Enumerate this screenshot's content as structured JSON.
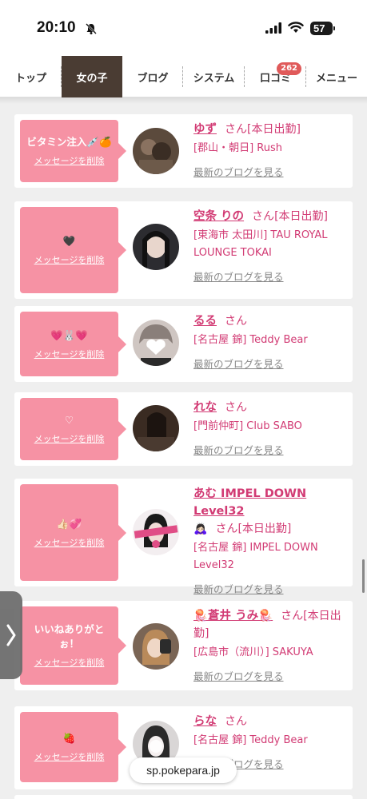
{
  "status_bar": {
    "time": "20:10",
    "battery": "57"
  },
  "nav": {
    "tabs": [
      {
        "label": "トップ"
      },
      {
        "label": "女の子"
      },
      {
        "label": "ブログ"
      },
      {
        "label": "システム"
      },
      {
        "label": "口コミ",
        "badge": "262"
      },
      {
        "label": "メニュー"
      }
    ]
  },
  "delete_label": "メッセージを削除",
  "san_label": "さん",
  "blog_label": "最新のブログを見る",
  "girls": [
    {
      "message": "ビタミン注入💉🍊",
      "name": "ゆず",
      "suffix": "[本日出勤]",
      "shop": "[郡山・朝日] Rush"
    },
    {
      "message": "🖤",
      "name": "空条 りの",
      "suffix": "[本日出勤]",
      "shop": "[東海市 太田川] TAU ROYAL LOUNGE TOKAI"
    },
    {
      "message": "💗🐰💗",
      "name": "るる",
      "suffix": "",
      "shop": "[名古屋 錦] Teddy Bear"
    },
    {
      "message": "♡",
      "name": "れな",
      "suffix": "",
      "shop": "[門前仲町] Club SABO"
    },
    {
      "message": "👍🏻💞",
      "name": "あむ IMPEL DOWN Level32",
      "name_extra": "🙇🏻‍♀️",
      "suffix": "[本日出勤]",
      "shop": "[名古屋 錦] IMPEL DOWN Level32"
    },
    {
      "message": "いいねありがとぉ！",
      "name": "🪼蒼井 うみ🪼",
      "suffix": "[本日出勤]",
      "shop": "[広島市（流川）] SAKUYA"
    },
    {
      "message": "🍓",
      "name": "らな",
      "suffix": "",
      "shop": "[名古屋 錦] Teddy Bear"
    }
  ],
  "url": "sp.pokepara.jp"
}
